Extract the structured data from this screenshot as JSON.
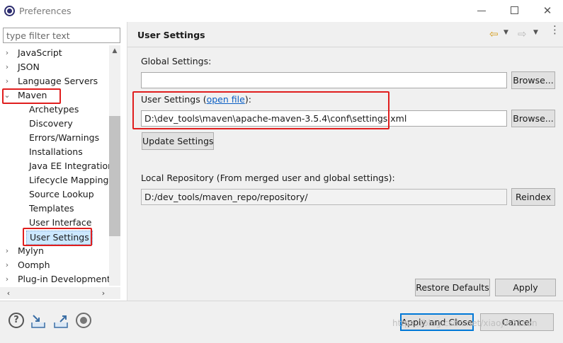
{
  "window": {
    "title": "Preferences",
    "minimize_glyph": "—",
    "maximize_glyph": "☐",
    "close_glyph": "✕"
  },
  "filter": {
    "placeholder": "type filter text",
    "value": ""
  },
  "tree": {
    "items": [
      {
        "label": "JavaScript",
        "twisty": "›",
        "level": 0
      },
      {
        "label": "JSON",
        "twisty": "›",
        "level": 0
      },
      {
        "label": "Language Servers",
        "twisty": "›",
        "level": 0
      },
      {
        "label": "Maven",
        "twisty": "⌄",
        "level": 0
      },
      {
        "label": "Archetypes",
        "twisty": "",
        "level": 1
      },
      {
        "label": "Discovery",
        "twisty": "",
        "level": 1
      },
      {
        "label": "Errors/Warnings",
        "twisty": "",
        "level": 1
      },
      {
        "label": "Installations",
        "twisty": "",
        "level": 1
      },
      {
        "label": "Java EE Integration",
        "twisty": "",
        "level": 1
      },
      {
        "label": "Lifecycle Mappings",
        "twisty": "",
        "level": 1
      },
      {
        "label": "Source Lookup",
        "twisty": "",
        "level": 1
      },
      {
        "label": "Templates",
        "twisty": "",
        "level": 1
      },
      {
        "label": "User Interface",
        "twisty": "",
        "level": 1
      },
      {
        "label": "User Settings",
        "twisty": "",
        "level": 1
      },
      {
        "label": "Mylyn",
        "twisty": "›",
        "level": 0
      },
      {
        "label": "Oomph",
        "twisty": "›",
        "level": 0
      },
      {
        "label": "Plug-in Development",
        "twisty": "›",
        "level": 0
      }
    ],
    "selected": "User Settings"
  },
  "scroll": {
    "up": "▲",
    "left": "‹",
    "right": "›"
  },
  "header": {
    "title": "User Settings",
    "back_glyph": "⇦",
    "forward_glyph": "⇨",
    "dropdown_glyph": "▼",
    "menu_glyph": "⋮"
  },
  "settings": {
    "global_label": "Global Settings:",
    "global_value": "",
    "browse_label": "Browse...",
    "user_label_prefix": "User Settings (",
    "open_file_link": "open file",
    "user_label_suffix": "):",
    "user_value": "D:\\dev_tools\\maven\\apache-maven-3.5.4\\conf\\settings.xml",
    "update_button": "Update Settings",
    "local_repo_label": "Local Repository (From merged user and global settings):",
    "local_repo_value": "D:/dev_tools/maven_repo/repository/",
    "reindex_button": "Reindex",
    "restore_defaults_button": "Restore Defaults",
    "apply_button": "Apply"
  },
  "footer": {
    "help_glyph": "?",
    "apply_close_button": "Apply and Close",
    "cancel_button": "Cancel",
    "watermark": "https://blog.csdn.net/xiaojin21cen"
  },
  "colors": {
    "highlight": "#e01e1e",
    "selection": "#cce8ff",
    "link": "#0b5fc4",
    "primary_border": "#0078d7"
  }
}
